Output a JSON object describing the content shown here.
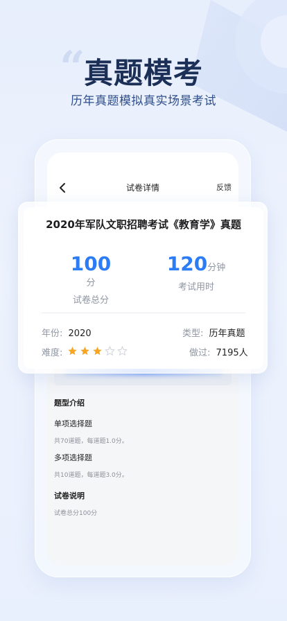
{
  "hero": {
    "title": "真题模考",
    "subtitle": "历年真题模拟真实场景考试"
  },
  "screen": {
    "title": "试卷详情",
    "feedback": "反馈"
  },
  "exam": {
    "title": "2020年军队文职招聘考试《教育学》真题",
    "score_value": "100",
    "score_unit": "分",
    "score_label": "试卷总分",
    "time_value": "120",
    "time_unit": "分钟",
    "time_label": "考试用时",
    "year_key": "年份:",
    "year_value": "2020",
    "type_key": "类型:",
    "type_value": "历年真题",
    "difficulty_key": "难度:",
    "difficulty_rating": 3,
    "difficulty_max": 5,
    "done_key": "做过:",
    "done_value": "7195人"
  },
  "intro": {
    "section_title": "题型介绍",
    "q1_title": "单项选择题",
    "q1_desc": "共70道题，每道题1.0分。",
    "q2_title": "多项选择题",
    "q2_desc": "共10道题，每道题3.0分。",
    "paper_title": "试卷说明",
    "paper_desc": "试卷总分100分"
  },
  "colors": {
    "accent": "#2c7cf6",
    "star_filled": "#f5a623",
    "star_empty": "#cfd3da"
  }
}
